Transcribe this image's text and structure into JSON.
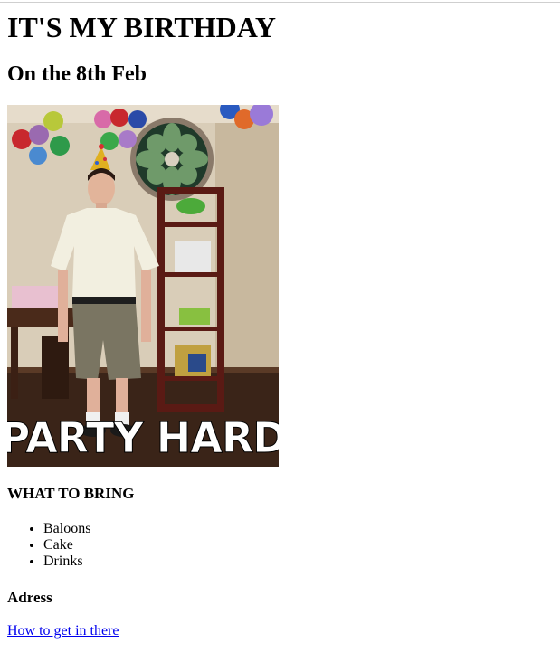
{
  "page": {
    "title": "IT'S MY BIRTHDAY",
    "subtitle": "On the 8th Feb"
  },
  "photo": {
    "caption": "PARTY HARD"
  },
  "bring": {
    "heading": "WHAT TO BRING",
    "items": [
      "Baloons",
      "Cake",
      "Drinks"
    ]
  },
  "address": {
    "heading": "Adress",
    "link_label": "How to get in there"
  },
  "colors": {
    "link": "#0000ee",
    "text": "#000000"
  }
}
